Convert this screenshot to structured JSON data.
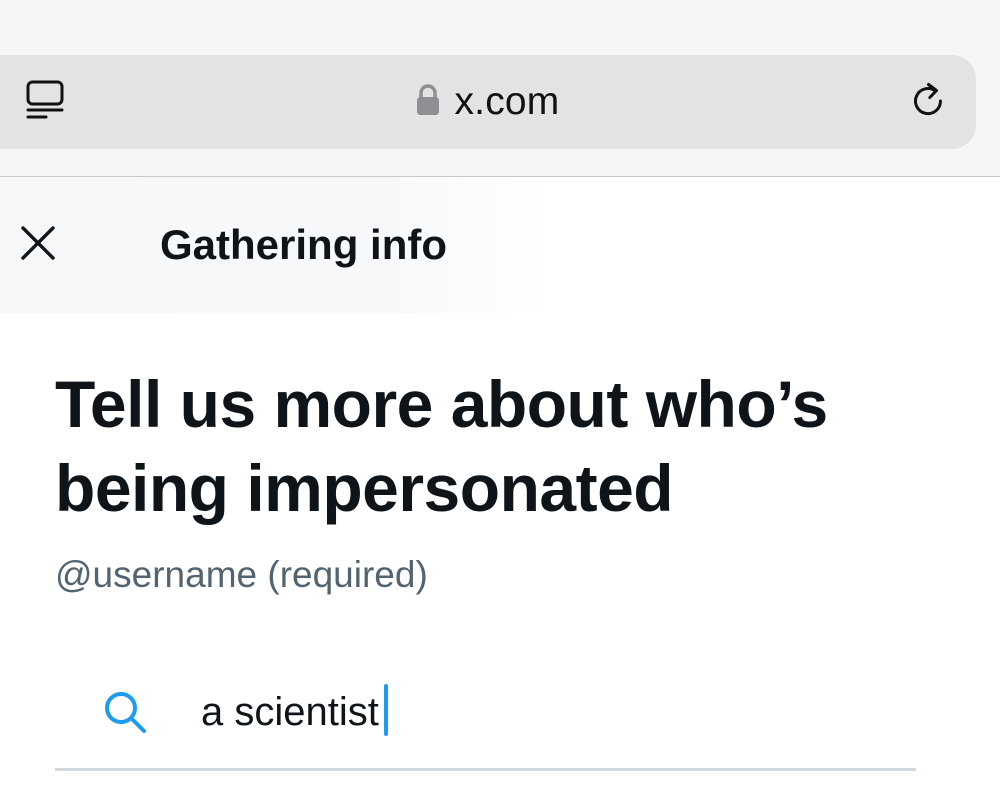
{
  "browser": {
    "url": "x.com",
    "icons": {
      "tabs": "tab-overview-icon",
      "lock": "lock-icon",
      "reload": "reload-icon"
    }
  },
  "header": {
    "title": "Gathering info",
    "close_icon": "close-icon"
  },
  "main": {
    "heading": "Tell us more about who’s being impersonated",
    "field_label": "@username (required)",
    "search": {
      "value": "a scientist",
      "icon": "search-icon"
    }
  },
  "colors": {
    "accent": "#1d9bf0",
    "text_primary": "#0f1419",
    "text_secondary": "#536471",
    "divider": "#cfd9de",
    "address_bar_bg": "#e3e3e3"
  }
}
